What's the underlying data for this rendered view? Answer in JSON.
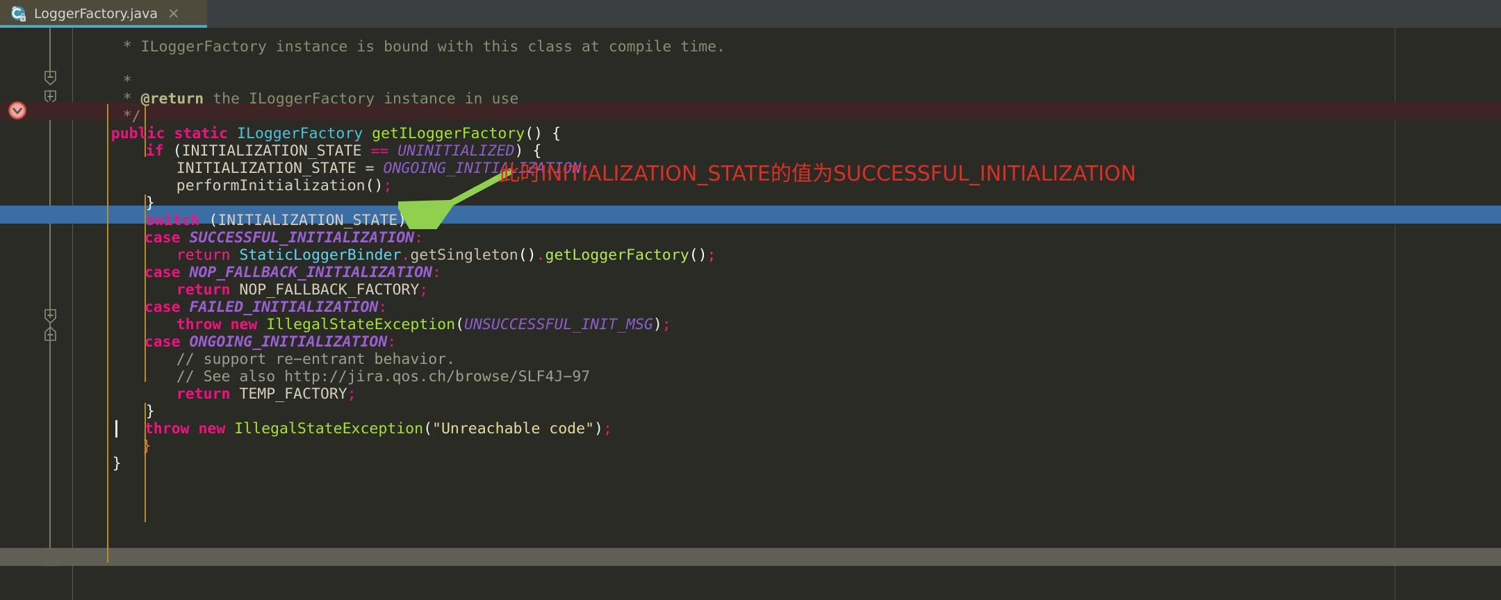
{
  "window": {
    "app": "java-editor",
    "background_color": "#2b2b26"
  },
  "tabbar": {
    "background_color": "#3c3f41",
    "active_tab": {
      "label": "LoggerFactory.java",
      "icon": "java-class-icon",
      "lock_badge": "lock-icon",
      "close_label": "✕",
      "background_color": "#4e4a3c",
      "underline_color": "#4ca6c4"
    }
  },
  "editor": {
    "breakpoint": {
      "icon": "breakpoint-disabled-icon",
      "color": "#e86c5c",
      "line_band_color": "#3d2425"
    },
    "selection_color": "#3a6ea5",
    "caret_line_color": "#5f5f55",
    "indent_guide_color": "#b98c2a",
    "margin_guide_color": "#4a4a42",
    "lines": [
      {
        "id": "l1",
        "text": " * ILoggerFactory instance is bound with this class at compile time."
      },
      {
        "id": "l2",
        "text": " *"
      },
      {
        "id": "l3",
        "text": " * @return the ILoggerFactory instance in use"
      },
      {
        "id": "l4",
        "text": " */"
      },
      {
        "id": "l5",
        "text": "public static ILoggerFactory getILoggerFactory() {"
      },
      {
        "id": "l6",
        "text": "    if (INITIALIZATION_STATE == UNINITIALIZED) {"
      },
      {
        "id": "l7",
        "text": "        INITIALIZATION_STATE = ONGOING_INITIALIZATION;"
      },
      {
        "id": "l8",
        "text": "        performInitialization();"
      },
      {
        "id": "l9",
        "text": "    }"
      },
      {
        "id": "l10",
        "text": "    switch (INITIALIZATION_STATE) {"
      },
      {
        "id": "l11",
        "text": "    case SUCCESSFUL_INITIALIZATION:"
      },
      {
        "id": "l12",
        "text": "        return StaticLoggerBinder.getSingleton().getLoggerFactory();"
      },
      {
        "id": "l13",
        "text": "    case NOP_FALLBACK_INITIALIZATION:"
      },
      {
        "id": "l14",
        "text": "        return NOP_FALLBACK_FACTORY;"
      },
      {
        "id": "l15",
        "text": "    case FAILED_INITIALIZATION:"
      },
      {
        "id": "l16",
        "text": "        throw new IllegalStateException(UNSUCCESSFUL_INIT_MSG);"
      },
      {
        "id": "l17",
        "text": "    case ONGOING_INITIALIZATION:"
      },
      {
        "id": "l18",
        "text": "        // support re-entrant behavior."
      },
      {
        "id": "l19",
        "text": "        // See also http://jira.qos.ch/browse/SLF4J-97"
      },
      {
        "id": "l20",
        "text": "        return TEMP_FACTORY;"
      },
      {
        "id": "l21",
        "text": "    }"
      },
      {
        "id": "l22",
        "text": "    throw new IllegalStateException(\"Unreachable code\");"
      },
      {
        "id": "l23",
        "text": "    }"
      },
      {
        "id": "l24",
        "text": "}"
      }
    ],
    "tokens": {
      "keywords": [
        "public",
        "static",
        "if",
        "switch",
        "case",
        "return",
        "throw",
        "new"
      ],
      "types": [
        "ILoggerFactory",
        "StaticLoggerBinder"
      ],
      "methods": [
        "getILoggerFactory",
        "performInitialization",
        "getSingleton",
        "getLoggerFactory",
        "IllegalStateException"
      ],
      "constants": [
        "UNINITIALIZED",
        "ONGOING_INITIALIZATION",
        "SUCCESSFUL_INITIALIZATION",
        "NOP_FALLBACK_INITIALIZATION",
        "FAILED_INITIALIZATION",
        "UNSUCCESSFUL_INIT_MSG"
      ],
      "string_literal": "\"Unreachable code\"",
      "doc_tag": "@return"
    },
    "selected_line_id": "l12",
    "breakpoint_line_id": "l6",
    "caret_line_id": "l23"
  },
  "annotation": {
    "text": "此时INITIALIZATION_STATE的值为SUCCESSFUL_INITIALIZATION",
    "color": "#d93025",
    "arrow": {
      "name": "green-arrow",
      "color": "#8fd14f",
      "direction": "down-left"
    }
  }
}
